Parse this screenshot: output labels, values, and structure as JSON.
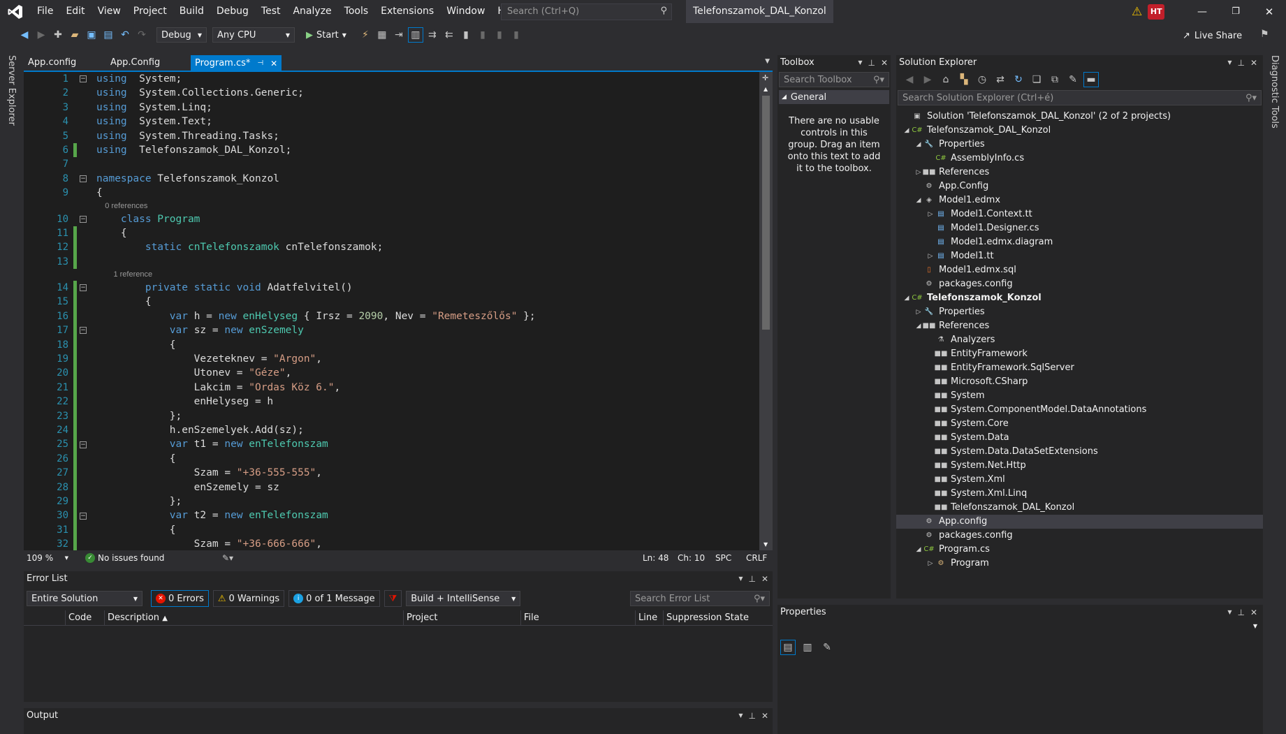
{
  "menu": [
    "File",
    "Edit",
    "View",
    "Project",
    "Build",
    "Debug",
    "Test",
    "Analyze",
    "Tools",
    "Extensions",
    "Window",
    "Help"
  ],
  "search_placeholder": "Search (Ctrl+Q)",
  "project_title": "Telefonszamok_DAL_Konzol",
  "user_initials": "HT",
  "toolbar": {
    "config": "Debug",
    "platform": "Any CPU",
    "start": "Start",
    "live_share": "Live Share"
  },
  "side": {
    "left": "Server Explorer",
    "right": "Diagnostic Tools"
  },
  "tabs": [
    {
      "label": "App.config"
    },
    {
      "label": "App.Config"
    },
    {
      "label": "Program.cs*"
    }
  ],
  "code_lines": [
    {
      "n": "1",
      "t": [
        [
          "kw",
          "using"
        ],
        [
          "",
          "  System;"
        ]
      ]
    },
    {
      "n": "2",
      "t": [
        [
          "kw",
          "using"
        ],
        [
          "",
          "  System.Collections.Generic;"
        ]
      ]
    },
    {
      "n": "3",
      "t": [
        [
          "kw",
          "using"
        ],
        [
          "",
          "  System.Linq;"
        ]
      ]
    },
    {
      "n": "4",
      "t": [
        [
          "kw",
          "using"
        ],
        [
          "",
          "  System.Text;"
        ]
      ]
    },
    {
      "n": "5",
      "t": [
        [
          "kw",
          "using"
        ],
        [
          "",
          "  System.Threading.Tasks;"
        ]
      ]
    },
    {
      "n": "6",
      "t": [
        [
          "kw",
          "using"
        ],
        [
          "",
          "  Telefonszamok_DAL_Konzol;"
        ]
      ]
    },
    {
      "n": "7",
      "t": []
    },
    {
      "n": "8",
      "t": [
        [
          "kw",
          "namespace"
        ],
        [
          "",
          " Telefonszamok_Konzol"
        ]
      ]
    },
    {
      "n": "9",
      "t": [
        [
          "",
          "{"
        ]
      ]
    },
    {
      "ref": "    0 references"
    },
    {
      "n": "10",
      "t": [
        [
          "",
          "    "
        ],
        [
          "kw",
          "class"
        ],
        [
          "",
          ""
        ],
        [
          "ty",
          " Program"
        ]
      ]
    },
    {
      "n": "11",
      "t": [
        [
          "",
          "    {"
        ]
      ]
    },
    {
      "n": "12",
      "t": [
        [
          "",
          "        "
        ],
        [
          "kw",
          "static"
        ],
        [
          "ty",
          " cnTelefonszamok"
        ],
        [
          "",
          " cnTelefonszamok;"
        ]
      ]
    },
    {
      "n": "13",
      "t": []
    },
    {
      "ref": "        1 reference"
    },
    {
      "n": "14",
      "t": [
        [
          "",
          "        "
        ],
        [
          "kw",
          "private static void"
        ],
        [
          "",
          " Adatfelvitel()"
        ]
      ]
    },
    {
      "n": "15",
      "t": [
        [
          "",
          "        {"
        ]
      ]
    },
    {
      "n": "16",
      "t": [
        [
          "",
          "            "
        ],
        [
          "kw",
          "var"
        ],
        [
          "",
          " h = "
        ],
        [
          "kw",
          "new"
        ],
        [
          "ty",
          " enHelyseg"
        ],
        [
          "",
          " { Irsz = "
        ],
        [
          "nu",
          "2090"
        ],
        [
          "",
          ", Nev = "
        ],
        [
          "st",
          "\"Remeteszőlős\""
        ],
        [
          "",
          " };"
        ]
      ]
    },
    {
      "n": "17",
      "t": [
        [
          "",
          "            "
        ],
        [
          "kw",
          "var"
        ],
        [
          "",
          " sz = "
        ],
        [
          "kw",
          "new"
        ],
        [
          "ty",
          " enSzemely"
        ]
      ]
    },
    {
      "n": "18",
      "t": [
        [
          "",
          "            {"
        ]
      ]
    },
    {
      "n": "19",
      "t": [
        [
          "",
          "                Vezeteknev = "
        ],
        [
          "st",
          "\"Argon\""
        ],
        [
          "",
          ","
        ]
      ]
    },
    {
      "n": "20",
      "t": [
        [
          "",
          "                Utonev = "
        ],
        [
          "st",
          "\"Géze\""
        ],
        [
          "",
          ","
        ]
      ]
    },
    {
      "n": "21",
      "t": [
        [
          "",
          "                Lakcim = "
        ],
        [
          "st",
          "\"Ordas Köz 6.\""
        ],
        [
          "",
          ","
        ]
      ]
    },
    {
      "n": "22",
      "t": [
        [
          "",
          "                enHelyseg = h"
        ]
      ]
    },
    {
      "n": "23",
      "t": [
        [
          "",
          "            };"
        ]
      ]
    },
    {
      "n": "24",
      "t": [
        [
          "",
          "            h.enSzemelyek.Add(sz);"
        ]
      ]
    },
    {
      "n": "25",
      "t": [
        [
          "",
          "            "
        ],
        [
          "kw",
          "var"
        ],
        [
          "",
          " t1 = "
        ],
        [
          "kw",
          "new"
        ],
        [
          "ty",
          " enTelefonszam"
        ]
      ]
    },
    {
      "n": "26",
      "t": [
        [
          "",
          "            {"
        ]
      ]
    },
    {
      "n": "27",
      "t": [
        [
          "",
          "                Szam = "
        ],
        [
          "st",
          "\"+36-555-555\""
        ],
        [
          "",
          ","
        ]
      ]
    },
    {
      "n": "28",
      "t": [
        [
          "",
          "                enSzemely = sz"
        ]
      ]
    },
    {
      "n": "29",
      "t": [
        [
          "",
          "            };"
        ]
      ]
    },
    {
      "n": "30",
      "t": [
        [
          "",
          "            "
        ],
        [
          "kw",
          "var"
        ],
        [
          "",
          " t2 = "
        ],
        [
          "kw",
          "new"
        ],
        [
          "ty",
          " enTelefonszam"
        ]
      ]
    },
    {
      "n": "31",
      "t": [
        [
          "",
          "            {"
        ]
      ]
    },
    {
      "n": "32",
      "t": [
        [
          "",
          "                Szam = "
        ],
        [
          "st",
          "\"+36-666-666\""
        ],
        [
          "",
          ","
        ]
      ]
    }
  ],
  "editor_status": {
    "zoom": "109 %",
    "issues": "No issues found",
    "ln": "Ln: 48",
    "ch": "Ch: 10",
    "spc": "SPC",
    "crlf": "CRLF"
  },
  "error_list": {
    "title": "Error List",
    "scope": "Entire Solution",
    "errors": "0 Errors",
    "warnings": "0 Warnings",
    "messages": "0 of 1 Message",
    "build": "Build + IntelliSense",
    "search": "Search Error List",
    "cols": [
      "Code",
      "Description",
      "Project",
      "File",
      "Line",
      "Suppression State"
    ]
  },
  "output": {
    "title": "Output"
  },
  "toolbox": {
    "title": "Toolbox",
    "search": "Search Toolbox",
    "group": "General",
    "empty": "There are no usable controls in this group. Drag an item onto this text to add it to the toolbox."
  },
  "solution": {
    "title": "Solution Explorer",
    "search": "Search Solution Explorer (Ctrl+é)",
    "items": [
      {
        "d": 0,
        "e": "",
        "i": "sln",
        "l": "Solution 'Telefonszamok_DAL_Konzol' (2 of 2 projects)"
      },
      {
        "d": 0,
        "e": "open",
        "i": "cs",
        "l": "Telefonszamok_DAL_Konzol"
      },
      {
        "d": 1,
        "e": "open",
        "i": "wr",
        "l": "Properties"
      },
      {
        "d": 2,
        "e": "",
        "i": "c#",
        "l": "AssemblyInfo.cs"
      },
      {
        "d": 1,
        "e": "closed",
        "i": "ref",
        "l": "References"
      },
      {
        "d": 1,
        "e": "",
        "i": "cfg",
        "l": "App.Config"
      },
      {
        "d": 1,
        "e": "open",
        "i": "edmx",
        "l": "Model1.edmx"
      },
      {
        "d": 2,
        "e": "closed",
        "i": "tt",
        "l": "Model1.Context.tt"
      },
      {
        "d": 2,
        "e": "",
        "i": "tt",
        "l": "Model1.Designer.cs"
      },
      {
        "d": 2,
        "e": "",
        "i": "tt",
        "l": "Model1.edmx.diagram"
      },
      {
        "d": 2,
        "e": "closed",
        "i": "tt",
        "l": "Model1.tt"
      },
      {
        "d": 1,
        "e": "",
        "i": "sql",
        "l": "Model1.edmx.sql"
      },
      {
        "d": 1,
        "e": "",
        "i": "cfg",
        "l": "packages.config"
      },
      {
        "d": 0,
        "e": "open",
        "i": "cs",
        "l": "Telefonszamok_Konzol",
        "bold": true
      },
      {
        "d": 1,
        "e": "closed",
        "i": "wr",
        "l": "Properties"
      },
      {
        "d": 1,
        "e": "open",
        "i": "ref",
        "l": "References"
      },
      {
        "d": 2,
        "e": "",
        "i": "an",
        "l": "Analyzers"
      },
      {
        "d": 2,
        "e": "",
        "i": "ref",
        "l": "EntityFramework"
      },
      {
        "d": 2,
        "e": "",
        "i": "ref",
        "l": "EntityFramework.SqlServer"
      },
      {
        "d": 2,
        "e": "",
        "i": "ref",
        "l": "Microsoft.CSharp"
      },
      {
        "d": 2,
        "e": "",
        "i": "ref",
        "l": "System"
      },
      {
        "d": 2,
        "e": "",
        "i": "ref",
        "l": "System.ComponentModel.DataAnnotations"
      },
      {
        "d": 2,
        "e": "",
        "i": "ref",
        "l": "System.Core"
      },
      {
        "d": 2,
        "e": "",
        "i": "ref",
        "l": "System.Data"
      },
      {
        "d": 2,
        "e": "",
        "i": "ref",
        "l": "System.Data.DataSetExtensions"
      },
      {
        "d": 2,
        "e": "",
        "i": "ref",
        "l": "System.Net.Http"
      },
      {
        "d": 2,
        "e": "",
        "i": "ref",
        "l": "System.Xml"
      },
      {
        "d": 2,
        "e": "",
        "i": "ref",
        "l": "System.Xml.Linq"
      },
      {
        "d": 2,
        "e": "",
        "i": "ref",
        "l": "Telefonszamok_DAL_Konzol"
      },
      {
        "d": 1,
        "e": "",
        "i": "cfg",
        "l": "App.config",
        "sel": true
      },
      {
        "d": 1,
        "e": "",
        "i": "cfg",
        "l": "packages.config"
      },
      {
        "d": 1,
        "e": "open",
        "i": "c#",
        "l": "Program.cs"
      },
      {
        "d": 2,
        "e": "closed",
        "i": "cls",
        "l": "Program"
      }
    ]
  },
  "properties": {
    "title": "Properties"
  }
}
